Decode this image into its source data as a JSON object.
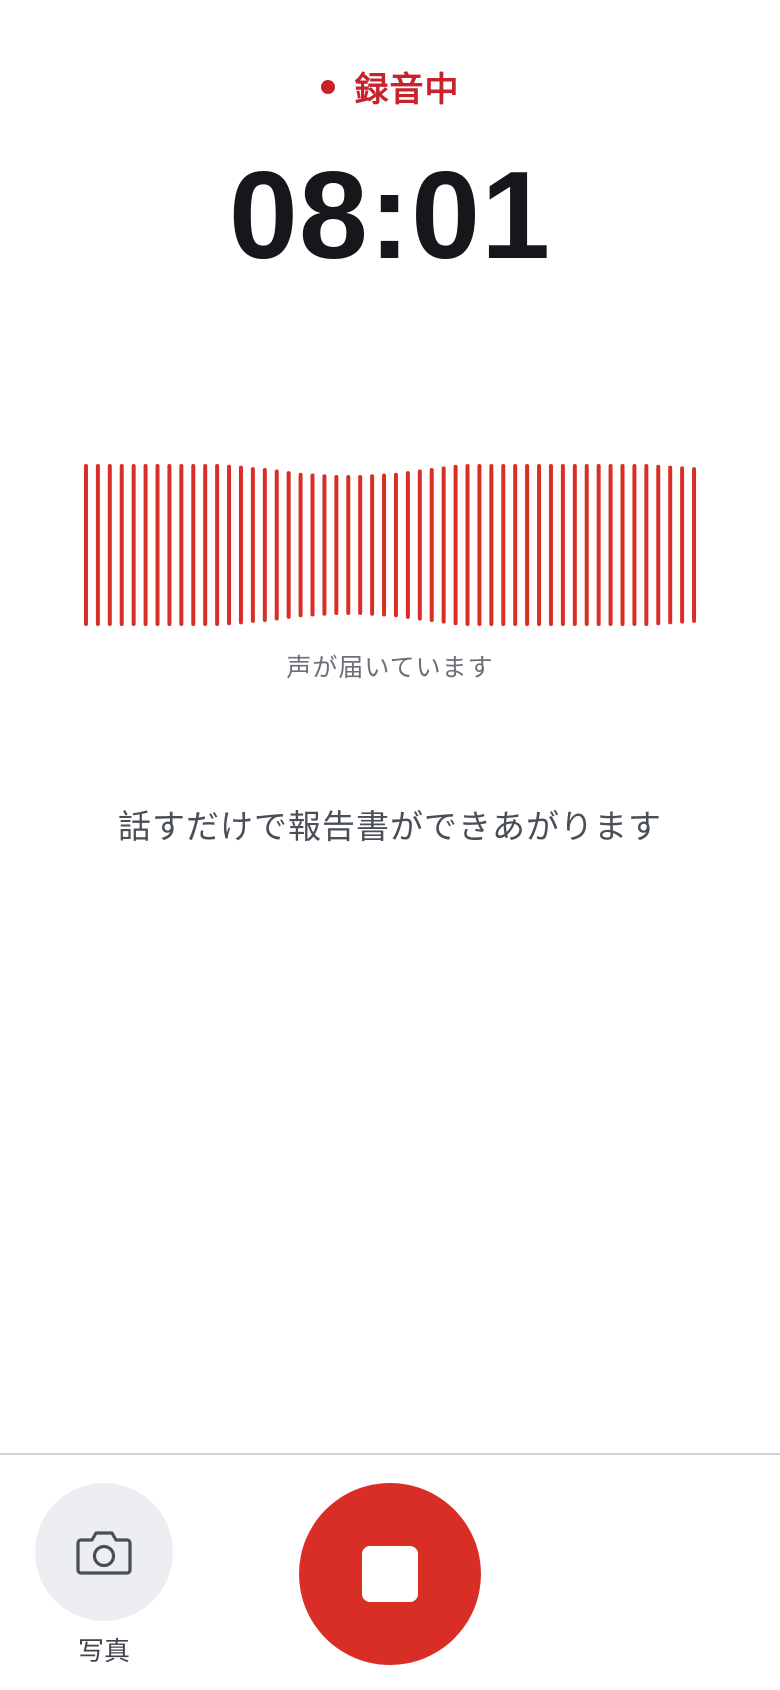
{
  "status": {
    "label": "録音中",
    "color": "#c8232c"
  },
  "timer": {
    "elapsed": "08:01"
  },
  "waveform": {
    "caption": "声が届いています",
    "bar_color": "#d92e25",
    "levels": [
      1.0,
      1.0,
      1.0,
      1.0,
      1.0,
      1.0,
      1.0,
      1.0,
      1.0,
      1.0,
      1.0,
      1.0,
      0.99,
      0.98,
      0.96,
      0.95,
      0.93,
      0.91,
      0.89,
      0.88,
      0.87,
      0.86,
      0.86,
      0.86,
      0.87,
      0.88,
      0.89,
      0.91,
      0.93,
      0.95,
      0.97,
      0.99,
      1.0,
      1.0,
      1.0,
      1.0,
      1.0,
      1.0,
      1.0,
      1.0,
      1.0,
      1.0,
      1.0,
      1.0,
      1.0,
      1.0,
      1.0,
      1.0,
      0.99,
      0.98,
      0.97,
      0.96
    ]
  },
  "hint": {
    "text": "話すだけで報告書ができあがります"
  },
  "bottom_bar": {
    "photo_label": "写真",
    "photo_icon": "camera-icon",
    "stop_icon": "stop-icon",
    "stop_color": "#d92e25"
  }
}
